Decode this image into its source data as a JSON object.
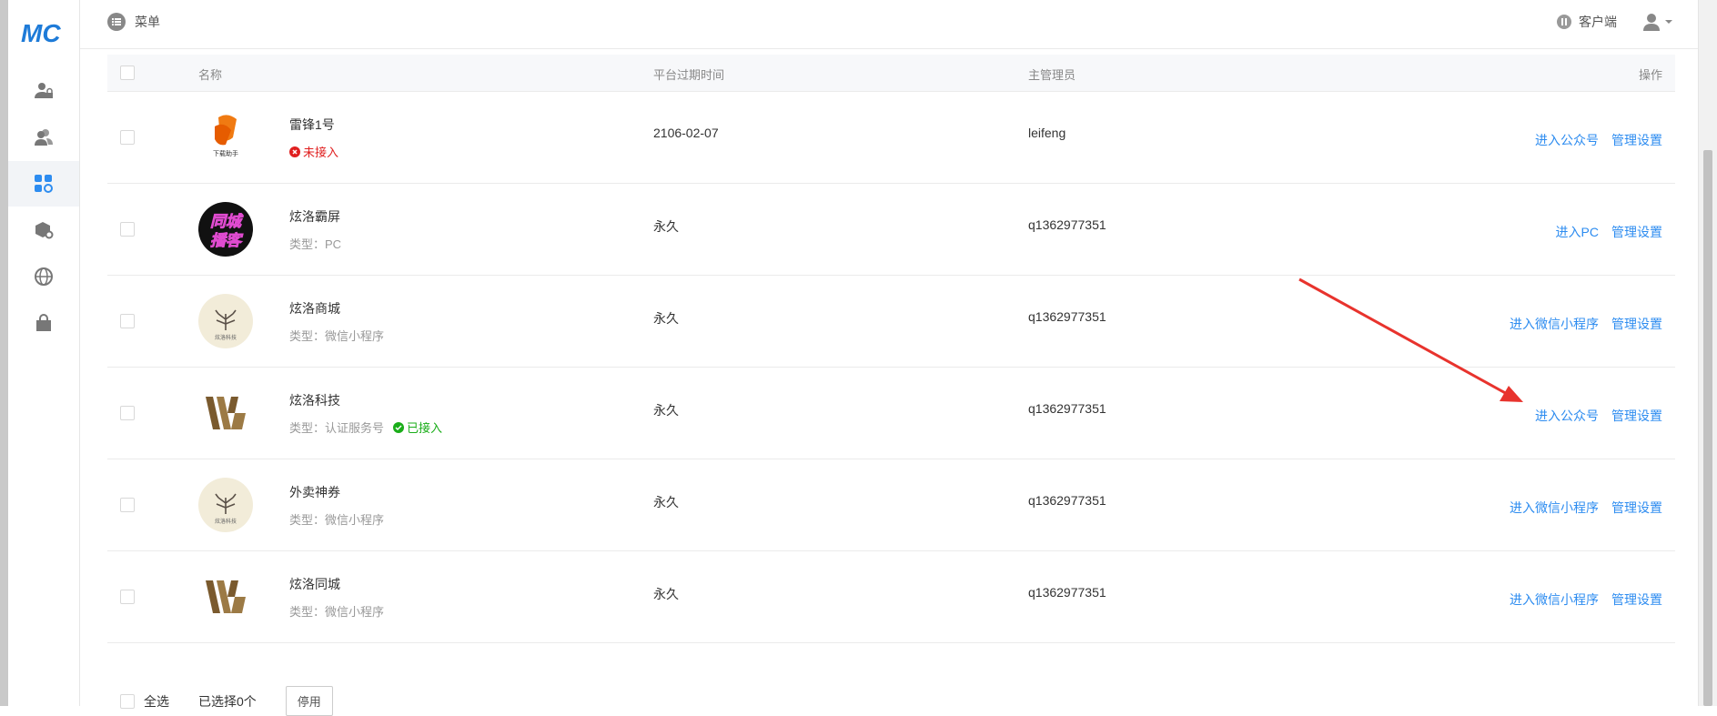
{
  "colors": {
    "link": "#2d8cf0",
    "danger": "#e02020",
    "success": "#1aad19",
    "arrow": "#e8332d",
    "logo": "#1e7bd8"
  },
  "logo": {
    "text": "MC",
    "icon": "mc-logo"
  },
  "sidebar": {
    "items": [
      {
        "icon": "user-lock-icon",
        "active": false
      },
      {
        "icon": "users-icon",
        "active": false
      },
      {
        "icon": "apps-gear-icon",
        "active": true
      },
      {
        "icon": "box-gear-icon",
        "active": false
      },
      {
        "icon": "globe-icon",
        "active": false
      },
      {
        "icon": "bag-icon",
        "active": false
      }
    ]
  },
  "header": {
    "menu_label": "菜单",
    "client_label": "客户端"
  },
  "table": {
    "columns": {
      "name": "名称",
      "expire": "平台过期时间",
      "admin": "主管理员",
      "ops": "操作"
    },
    "rows": [
      {
        "name": "雷锋1号",
        "avatar": "leifeng-logo",
        "status": "未接入",
        "expire": "2106-02-07",
        "admin": "leifeng",
        "enter": "进入公众号",
        "manage": "管理设置"
      },
      {
        "name": "炫洛霸屏",
        "avatar": "tongcheng-logo",
        "type": "类型：PC",
        "expire": "永久",
        "admin": "q1362977351",
        "enter": "进入PC",
        "manage": "管理设置"
      },
      {
        "name": "炫洛商城",
        "avatar": "tree-logo",
        "type": "类型：微信小程序",
        "expire": "永久",
        "admin": "q1362977351",
        "enter": "进入微信小程序",
        "manage": "管理设置"
      },
      {
        "name": "炫洛科技",
        "avatar": "xl-logo",
        "type": "类型：认证服务号",
        "status_ok": "已接入",
        "expire": "永久",
        "admin": "q1362977351",
        "enter": "进入公众号",
        "manage": "管理设置"
      },
      {
        "name": "外卖神券",
        "avatar": "tree-logo",
        "type": "类型：微信小程序",
        "expire": "永久",
        "admin": "q1362977351",
        "enter": "进入微信小程序",
        "manage": "管理设置"
      },
      {
        "name": "炫洛同城",
        "avatar": "xl-logo",
        "type": "类型：微信小程序",
        "expire": "永久",
        "admin": "q1362977351",
        "enter": "进入微信小程序",
        "manage": "管理设置"
      }
    ]
  },
  "footer": {
    "select_all": "全选",
    "selected": "已选择0个",
    "disable_button": "停用"
  },
  "logo_texts": {
    "leifeng": "下载助手",
    "tongcheng_top": "同城",
    "tongcheng_bottom": "播客",
    "tree": "炫洛科技"
  }
}
